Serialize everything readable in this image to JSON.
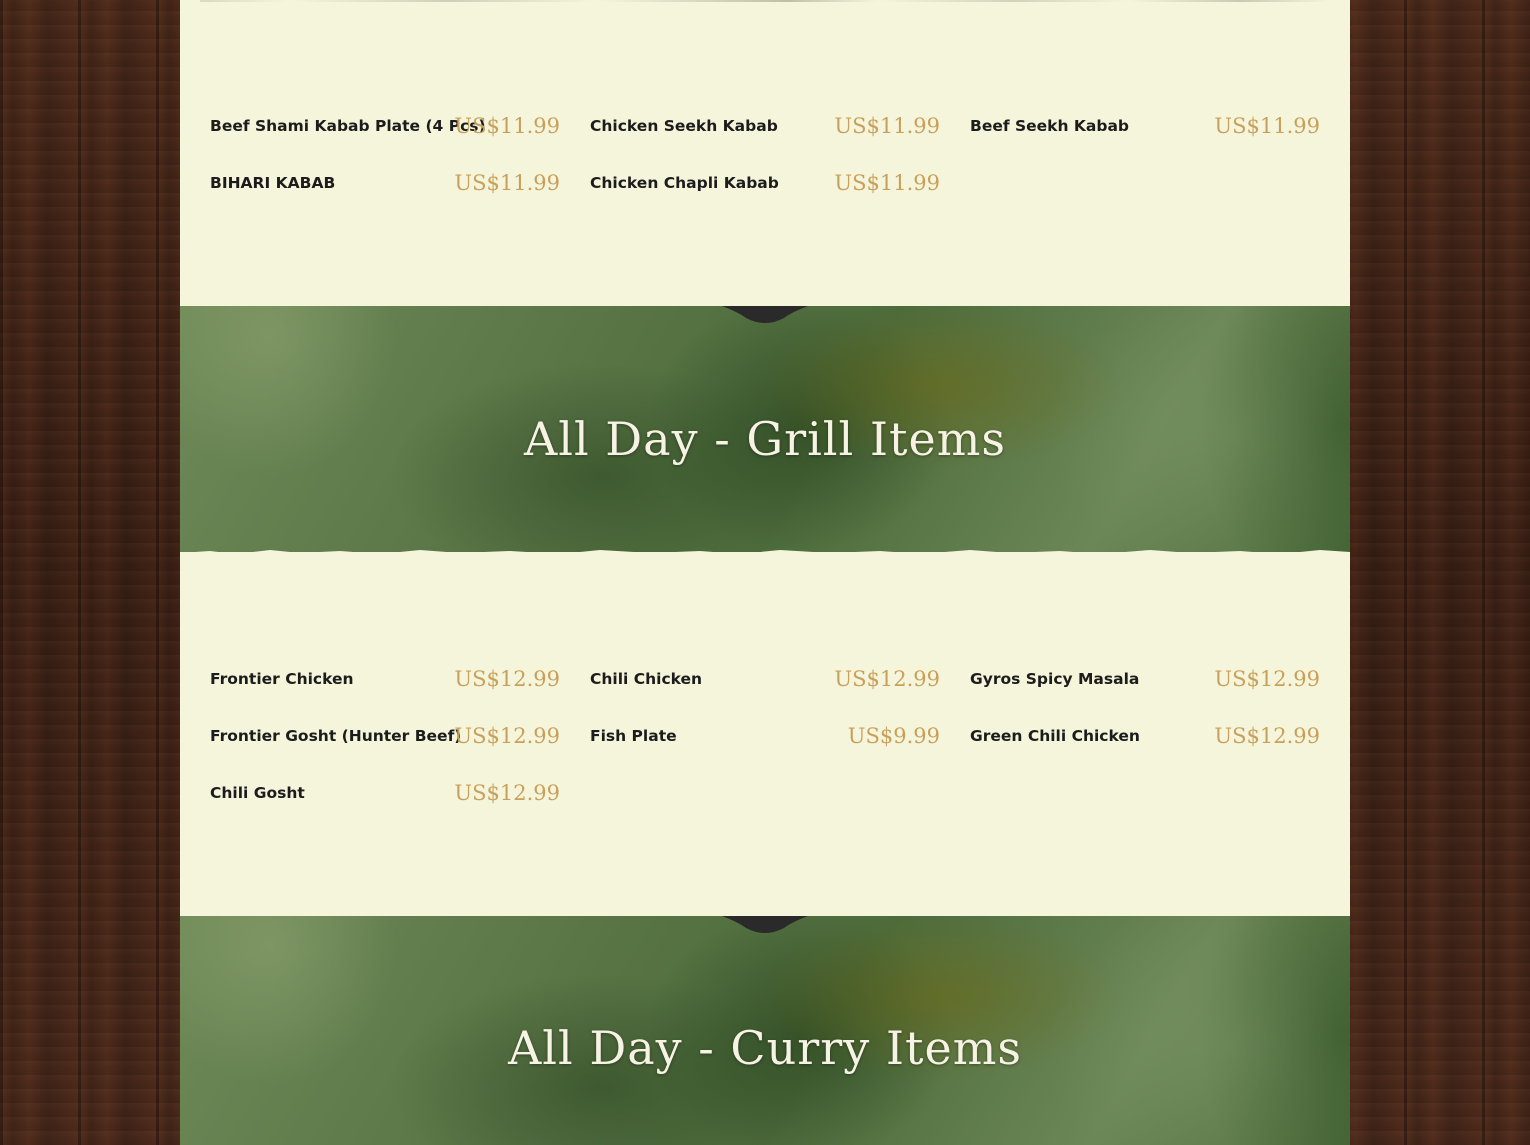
{
  "colors": {
    "panel_background": "#f5f5dc",
    "price_text": "#c9a05b",
    "item_text": "#1c1c1c",
    "banner_title_text": "#f7f3e4",
    "banner_tab": "#2a2a2a",
    "wood_background": "#3b2419"
  },
  "kabab_section": {
    "items": [
      {
        "name": "Beef Shami Kabab Plate (4 Pcs)",
        "price": "US$11.99"
      },
      {
        "name": "Chicken Seekh Kabab",
        "price": "US$11.99"
      },
      {
        "name": "Beef Seekh Kabab",
        "price": "US$11.99"
      },
      {
        "name": "BIHARI KABAB",
        "price": "US$11.99"
      },
      {
        "name": "Chicken Chapli Kabab",
        "price": "US$11.99"
      }
    ]
  },
  "grill_banner": {
    "title": "All Day - Grill Items"
  },
  "grill_section": {
    "items": [
      {
        "name": "Frontier Chicken",
        "price": "US$12.99"
      },
      {
        "name": "Chili Chicken",
        "price": "US$12.99"
      },
      {
        "name": "Gyros Spicy Masala",
        "price": "US$12.99"
      },
      {
        "name": "Frontier Gosht (Hunter Beef)",
        "price": "US$12.99"
      },
      {
        "name": "Fish Plate",
        "price": "US$9.99"
      },
      {
        "name": "Green Chili Chicken",
        "price": "US$12.99"
      },
      {
        "name": "Chili Gosht",
        "price": "US$12.99"
      }
    ]
  },
  "curry_banner": {
    "title": "All Day - Curry Items"
  }
}
